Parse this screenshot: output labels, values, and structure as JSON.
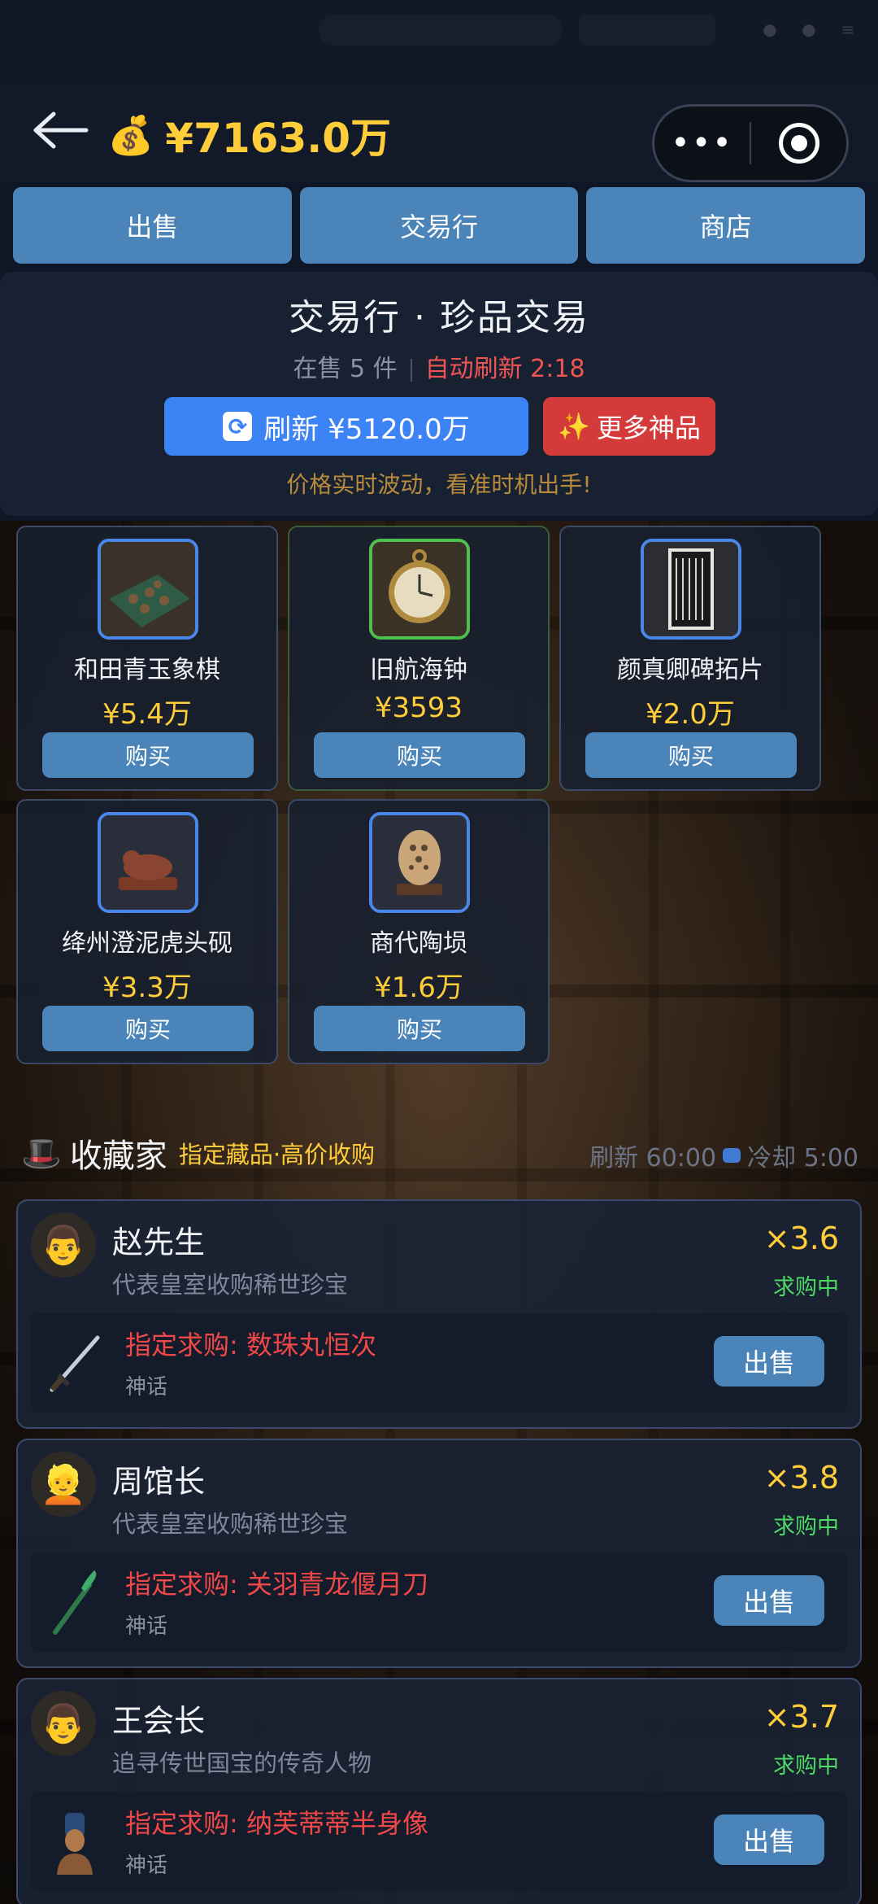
{
  "header": {
    "money_icon": "money-bag-icon",
    "balance": "¥7163.0万"
  },
  "tabs": [
    {
      "label": "出售"
    },
    {
      "label": "交易行"
    },
    {
      "label": "商店"
    }
  ],
  "trade": {
    "title": "交易行 · 珍品交易",
    "on_sale": "在售 5 件",
    "auto_refresh": "自动刷新 2:18",
    "refresh_label": "刷新 ¥5120.0万",
    "more_label": "更多神品",
    "hint": "价格实时波动，看准时机出手!"
  },
  "items": [
    {
      "name": "和田青玉象棋",
      "price": "¥5.4万",
      "buy": "购买",
      "frame": "blue"
    },
    {
      "name": "旧航海钟",
      "price": "¥3593",
      "buy": "购买",
      "frame": "green"
    },
    {
      "name": "颜真卿碑拓片",
      "price": "¥2.0万",
      "buy": "购买",
      "frame": "blue"
    },
    {
      "name": "绛州澄泥虎头砚",
      "price": "¥3.3万",
      "buy": "购买",
      "frame": "blue"
    },
    {
      "name": "商代陶埙",
      "price": "¥1.6万",
      "buy": "购买",
      "frame": "blue"
    }
  ],
  "collectors_section": {
    "title": "收藏家",
    "tag": "指定藏品·高价收购",
    "refresh": "刷新 60:00",
    "cooldown": "冷却 5:00"
  },
  "collectors": [
    {
      "name": "赵先生",
      "desc": "代表皇室收购稀世珍宝",
      "mult": "×3.6",
      "status": "求购中",
      "request": "指定求购: 数珠丸恒次",
      "rarity": "神话",
      "sell": "出售",
      "avatar": "man-face-icon"
    },
    {
      "name": "周馆长",
      "desc": "代表皇室收购稀世珍宝",
      "mult": "×3.8",
      "status": "求购中",
      "request": "指定求购: 关羽青龙偃月刀",
      "rarity": "神话",
      "sell": "出售",
      "avatar": "woman-face-icon"
    },
    {
      "name": "王会长",
      "desc": "追寻传世国宝的传奇人物",
      "mult": "×3.7",
      "status": "求购中",
      "request": "指定求购: 纳芙蒂蒂半身像",
      "rarity": "神话",
      "sell": "出售",
      "avatar": "man-face-icon"
    }
  ],
  "colors": {
    "gold": "#ffcd3a",
    "button_blue": "#4a84b8",
    "refresh_blue": "#3c83f6",
    "red": "#d43a3a",
    "green_status": "#4cd964"
  }
}
